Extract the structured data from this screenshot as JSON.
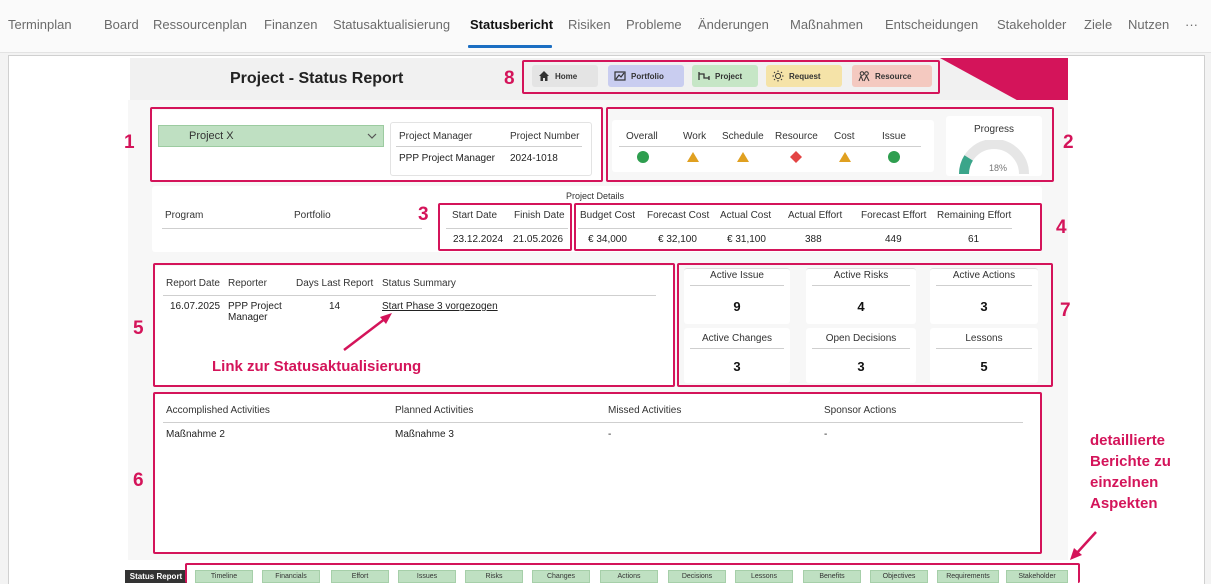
{
  "top_tabs": [
    "Terminplan",
    "Board",
    "Ressourcenplan",
    "Finanzen",
    "Statusaktualisierung",
    "Statusbericht",
    "Risiken",
    "Probleme",
    "Änderungen",
    "Maßnahmen",
    "Entscheidungen",
    "Stakeholder",
    "Ziele",
    "Nutzen"
  ],
  "more_label": "···",
  "report": {
    "title": "Project - Status Report",
    "nav": [
      "Home",
      "Portfolio",
      "Project",
      "Request",
      "Resource"
    ],
    "project_select": "Project X",
    "pm_header": "Project Manager",
    "pn_header": "Project Number",
    "pm_value": "PPP Project Manager",
    "pn_value": "2024-1018"
  },
  "status": {
    "headers": [
      "Overall",
      "Work",
      "Schedule",
      "Resource",
      "Cost",
      "Issue"
    ],
    "indicators": [
      "green-circle",
      "amber-triangle",
      "amber-triangle",
      "red-diamond",
      "amber-triangle",
      "green-circle"
    ],
    "colors": {
      "green": "#2e9e4f",
      "amber": "#e0a020",
      "red": "#e34444"
    }
  },
  "progress": {
    "title": "Progress",
    "label": "18%",
    "value": 0.18
  },
  "details": {
    "section_title": "Project Details",
    "program": "Program",
    "portfolio": "Portfolio",
    "start_date_h": "Start Date",
    "finish_date_h": "Finish Date",
    "start_date": "23.12.2024",
    "finish_date": "21.05.2026",
    "cost_headers": [
      "Budget Cost",
      "Forecast Cost",
      "Actual Cost",
      "Actual Effort",
      "Forecast Effort",
      "Remaining Effort"
    ],
    "cost_values": [
      "€ 34,000",
      "€ 32,100",
      "€ 31,100",
      "388",
      "449",
      "61"
    ]
  },
  "report_row": {
    "headers": [
      "Report Date",
      "Reporter",
      "Days Last Report",
      "Status Summary"
    ],
    "date": "16.07.2025",
    "reporter_line1": "PPP Project",
    "reporter_line2": "Manager",
    "days": "14",
    "summary": "Start Phase 3 vorgezogen"
  },
  "link_annotation": "Link zur Statusaktualisierung",
  "kpis": [
    {
      "title": "Active Issue",
      "value": "9"
    },
    {
      "title": "Active Risks",
      "value": "4"
    },
    {
      "title": "Active Actions",
      "value": "3"
    },
    {
      "title": "Active Changes",
      "value": "3"
    },
    {
      "title": "Open Decisions",
      "value": "3"
    },
    {
      "title": "Lessons",
      "value": "5"
    }
  ],
  "activities": {
    "headers": [
      "Accomplished Activities",
      "Planned Activities",
      "Missed Activities",
      "Sponsor Actions"
    ],
    "values": [
      "Maßnahme 2",
      "Maßnahme 3",
      "-",
      "-"
    ]
  },
  "annotations": {
    "n1": "1",
    "n2": "2",
    "n3": "3",
    "n4": "4",
    "n5": "5",
    "n6": "6",
    "n7": "7",
    "n8": "8",
    "side_note_1": "detaillierte",
    "side_note_2": "Berichte zu",
    "side_note_3": "einzelnen",
    "side_note_4": "Aspekten"
  },
  "bottom_tabs": {
    "active": "Status Report",
    "items": [
      "Timeline",
      "Financials",
      "Effort",
      "Issues",
      "Risks",
      "Changes",
      "Actions",
      "Decisions",
      "Lessons",
      "Benefits",
      "Objectives",
      "Requirements",
      "Stakeholder"
    ]
  }
}
